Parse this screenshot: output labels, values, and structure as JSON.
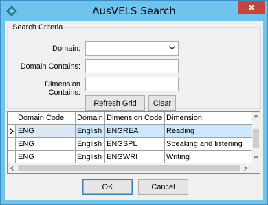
{
  "window": {
    "title": "AusVELS Search"
  },
  "icons": {
    "app": "app-diamond-icon",
    "close": "close-icon"
  },
  "search": {
    "group_label": "Search Criteria",
    "domain_label": "Domain:",
    "domain_value": "",
    "domain_contains_label": "Domain Contains:",
    "domain_contains_value": "",
    "dimension_contains_label": "Dimension Contains:",
    "dimension_contains_value": "",
    "refresh_label": "Refresh Grid",
    "clear_label": "Clear"
  },
  "grid": {
    "columns": [
      "Domain Code",
      "Domain",
      "Dimension Code",
      "Dimension"
    ],
    "rows": [
      [
        "ENG",
        "English",
        "ENGREA",
        "Reading"
      ],
      [
        "ENG",
        "English",
        "ENGSPL",
        "Speaking and listening"
      ],
      [
        "ENG",
        "English",
        "ENGWRI",
        "Writing"
      ]
    ],
    "selected_row": 0
  },
  "footer": {
    "ok_label": "OK",
    "cancel_label": "Cancel"
  },
  "colors": {
    "titlebar": "#6fc4ee",
    "close": "#c7443a",
    "selection": "#cce8ff"
  }
}
